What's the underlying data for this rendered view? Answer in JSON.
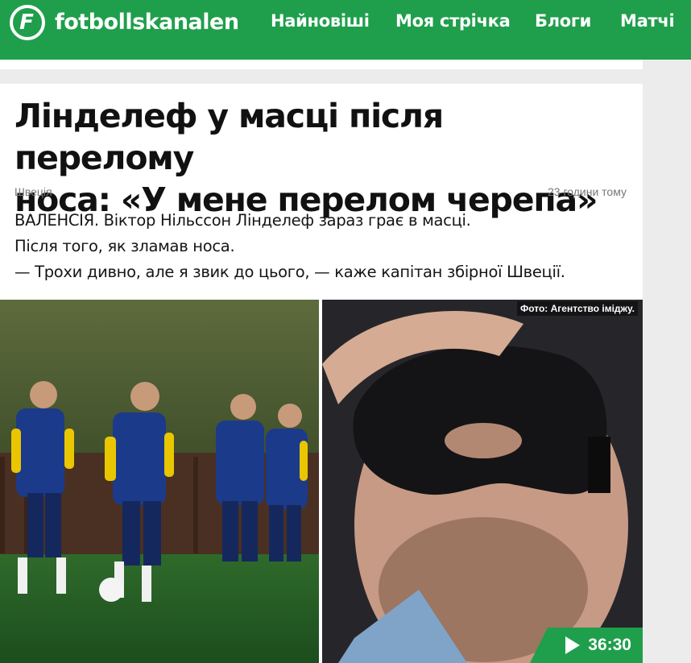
{
  "header": {
    "brand": "fotbollskanalen",
    "logo_letter": "F",
    "nav": [
      "Найновіші",
      "Моя стрічка",
      "Блоги",
      "Матчі"
    ]
  },
  "article": {
    "title_line1": "Лінделеф у масці після перелому",
    "title_line2": "носа: «У мене перелом черепа»",
    "category": "Швеція",
    "time": "23 години тому",
    "lead": [
      "ВАЛЕНСІЯ. Віктор Нільссон Лінделеф зараз грає в масці.",
      "Після того, як зламав носа.",
      "— Трохи дивно, але я звик до цього, — каже капітан збірної Швеції."
    ],
    "photo_credit": "Фото: Агентство іміджу.",
    "video_duration": "36:30"
  },
  "colors": {
    "brand_green": "#1f9f4b",
    "text": "#111111",
    "meta": "#777777"
  }
}
